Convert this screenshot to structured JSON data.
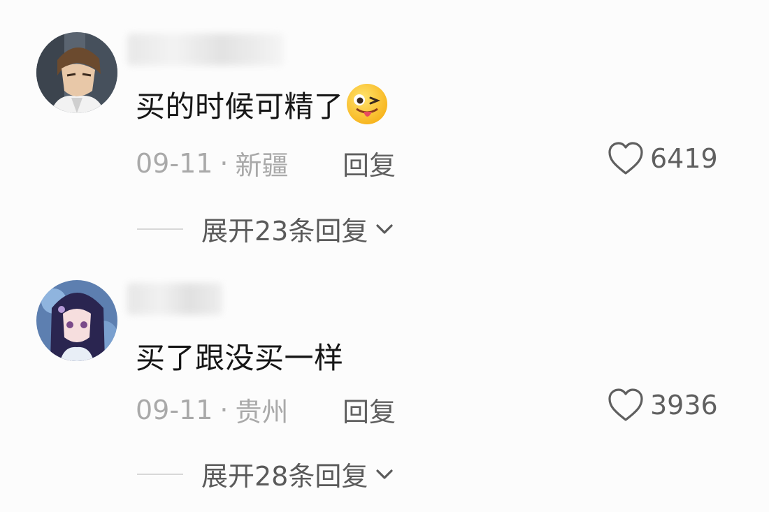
{
  "comments": [
    {
      "text": "买的时候可精了",
      "emoji_icon": "winking-face-tongue-emoji",
      "date": "09-11",
      "separator": "·",
      "location": "新疆",
      "reply_label": "回复",
      "likes": "6419",
      "expand_label": "展开23条回复"
    },
    {
      "text": "买了跟没买一样",
      "date": "09-11",
      "separator": "·",
      "location": "贵州",
      "reply_label": "回复",
      "likes": "3936",
      "expand_label": "展开28条回复"
    }
  ],
  "icons": {
    "like": "heart-outline-icon",
    "expand": "chevron-down-icon"
  },
  "colors": {
    "background": "#fcfcfc",
    "text_primary": "#161616",
    "text_meta": "#a9a9a9",
    "text_secondary": "#5f5f5f"
  }
}
